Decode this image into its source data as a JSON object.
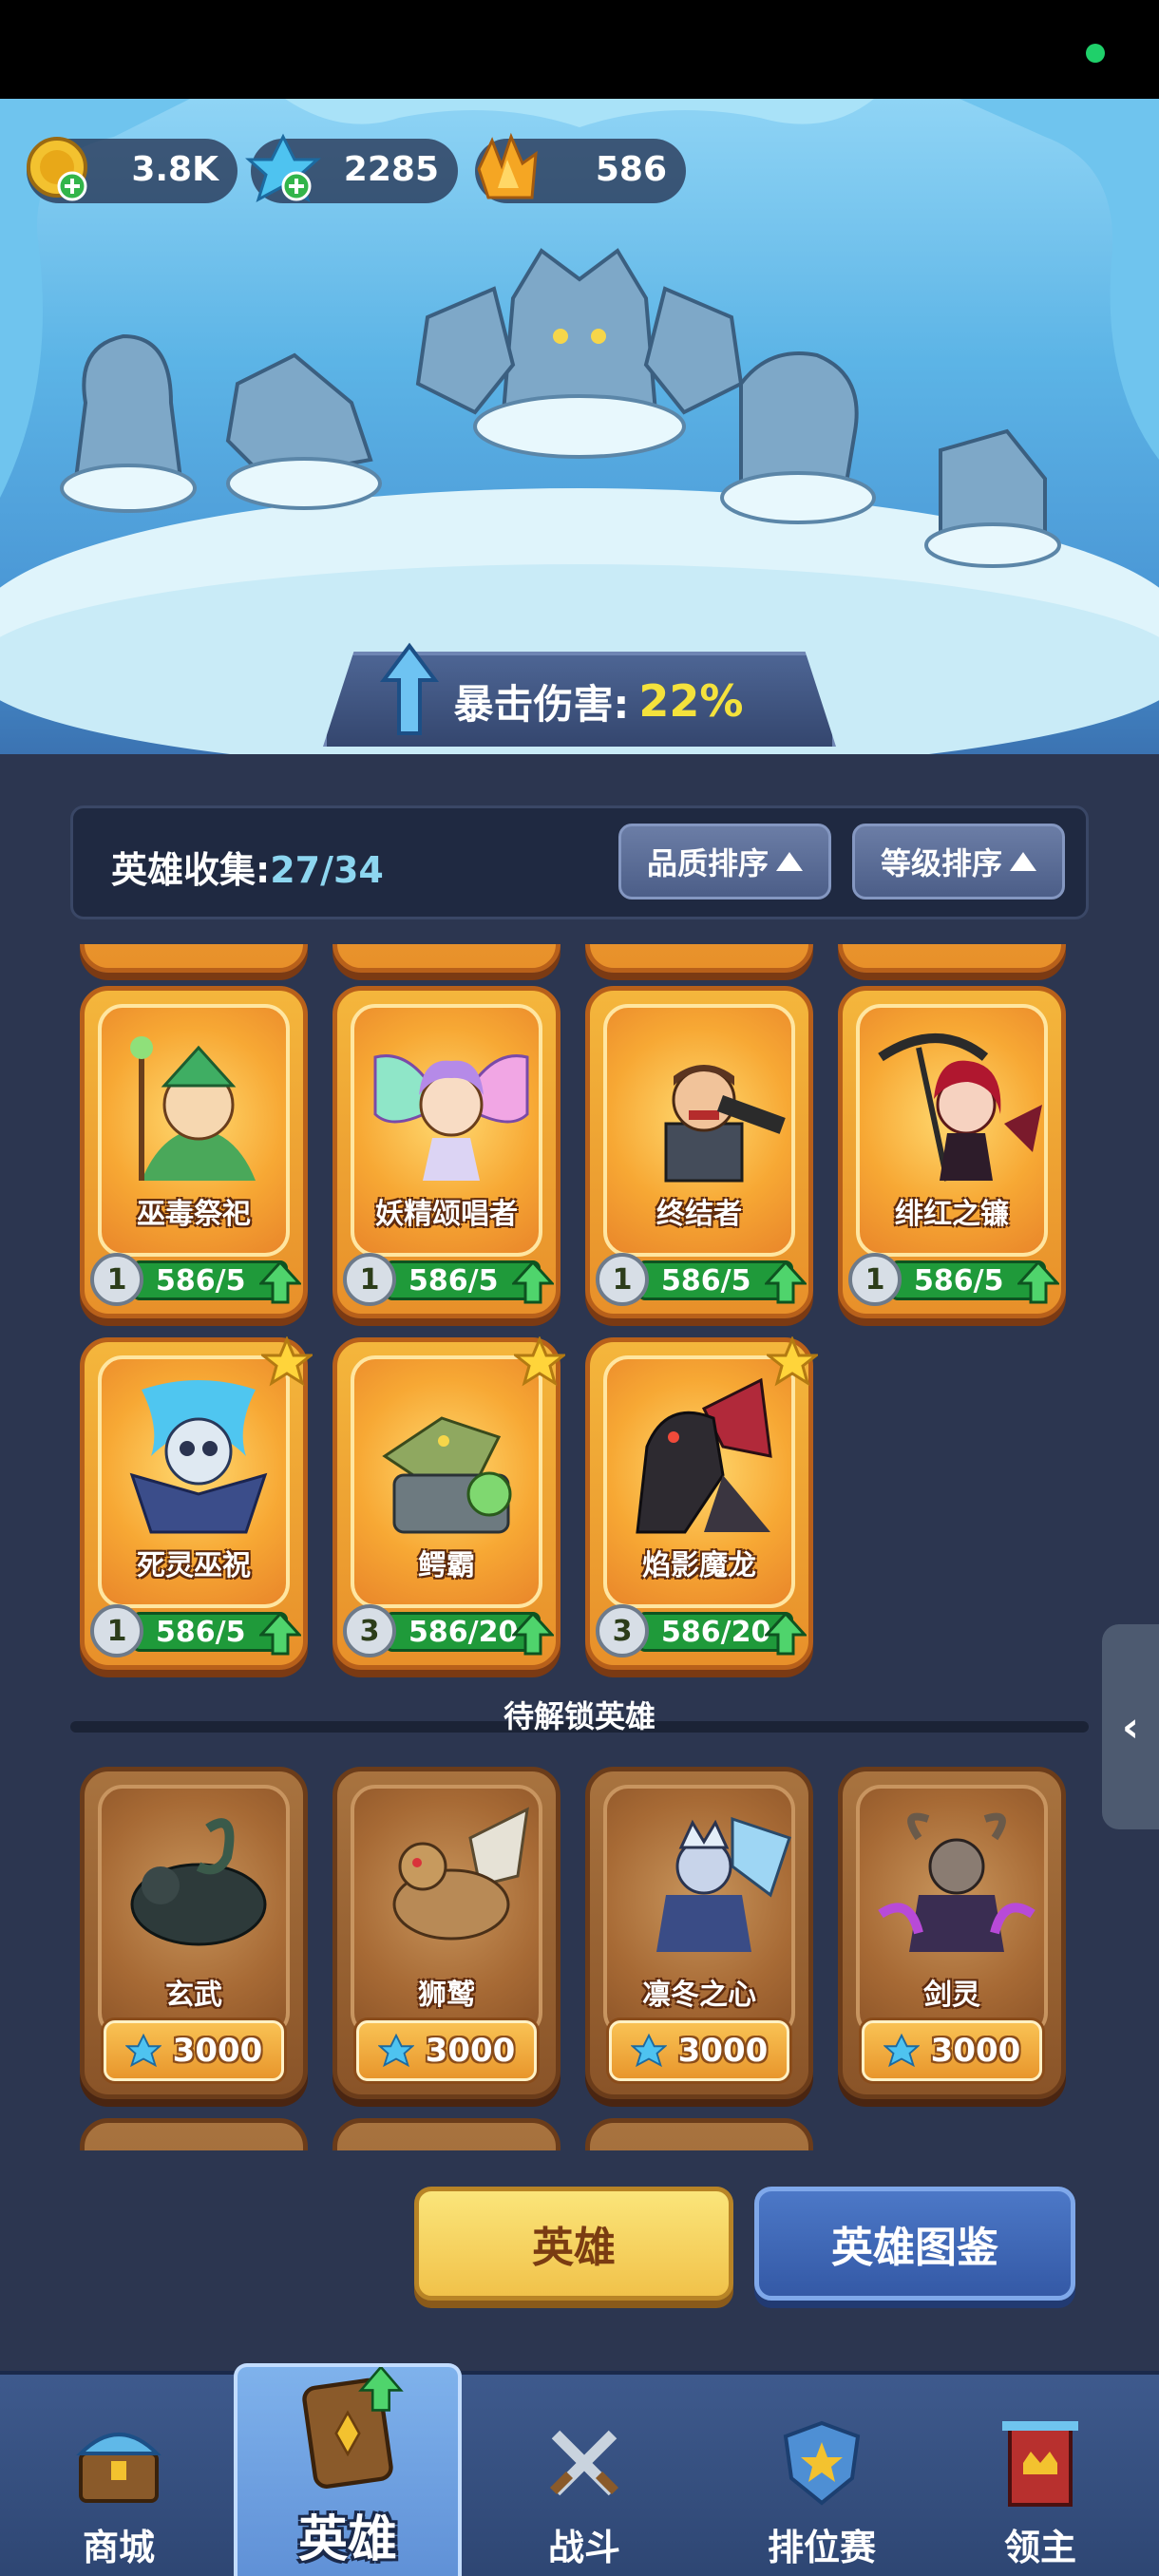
{
  "currencies": {
    "gold": {
      "value": "3.8K",
      "icon": "gold-coin-icon"
    },
    "crystal": {
      "value": "2285",
      "icon": "blue-crystal-icon"
    },
    "gem": {
      "value": "586",
      "icon": "orange-gem-icon"
    }
  },
  "banner": {
    "crit_label": "暴击伤害:",
    "crit_value": "22%"
  },
  "collection": {
    "title": "英雄收集:",
    "count": "27/34",
    "sort_quality": "品质排序",
    "sort_level": "等级排序"
  },
  "owned_heroes": [
    {
      "name": "巫毒祭祀",
      "level": "1",
      "progress": "586/5",
      "star": false,
      "progress_fraction": 1
    },
    {
      "name": "妖精颂唱者",
      "level": "1",
      "progress": "586/5",
      "star": false,
      "progress_fraction": 1
    },
    {
      "name": "终结者",
      "level": "1",
      "progress": "586/5",
      "star": false,
      "progress_fraction": 1
    },
    {
      "name": "绯红之镰",
      "level": "1",
      "progress": "586/5",
      "star": false,
      "progress_fraction": 1
    },
    {
      "name": "死灵巫祝",
      "level": "1",
      "progress": "586/5",
      "star": true,
      "progress_fraction": 1
    },
    {
      "name": "鳄霸",
      "level": "3",
      "progress": "586/20",
      "star": true,
      "progress_fraction": 1
    },
    {
      "name": "焰影魔龙",
      "level": "3",
      "progress": "586/20",
      "star": true,
      "progress_fraction": 1
    }
  ],
  "locked_section_label": "待解锁英雄",
  "locked_heroes": [
    {
      "name": "玄武",
      "cost": "3000"
    },
    {
      "name": "狮鹫",
      "cost": "3000"
    },
    {
      "name": "凛冬之心",
      "cost": "3000"
    },
    {
      "name": "剑灵",
      "cost": "3000"
    }
  ],
  "buttons": {
    "heroes": "英雄",
    "hero_codex": "英雄图鉴"
  },
  "side_tab": "‹",
  "nav": {
    "shop": "商城",
    "heroes": "英雄",
    "battle": "战斗",
    "ranked": "排位赛",
    "lord": "领主"
  },
  "colors": {
    "progress_green": "#1f9a3a",
    "crit_yellow": "#f4e23c",
    "count_blue": "#8dd6f0",
    "card_orange": "#f4b63c"
  }
}
